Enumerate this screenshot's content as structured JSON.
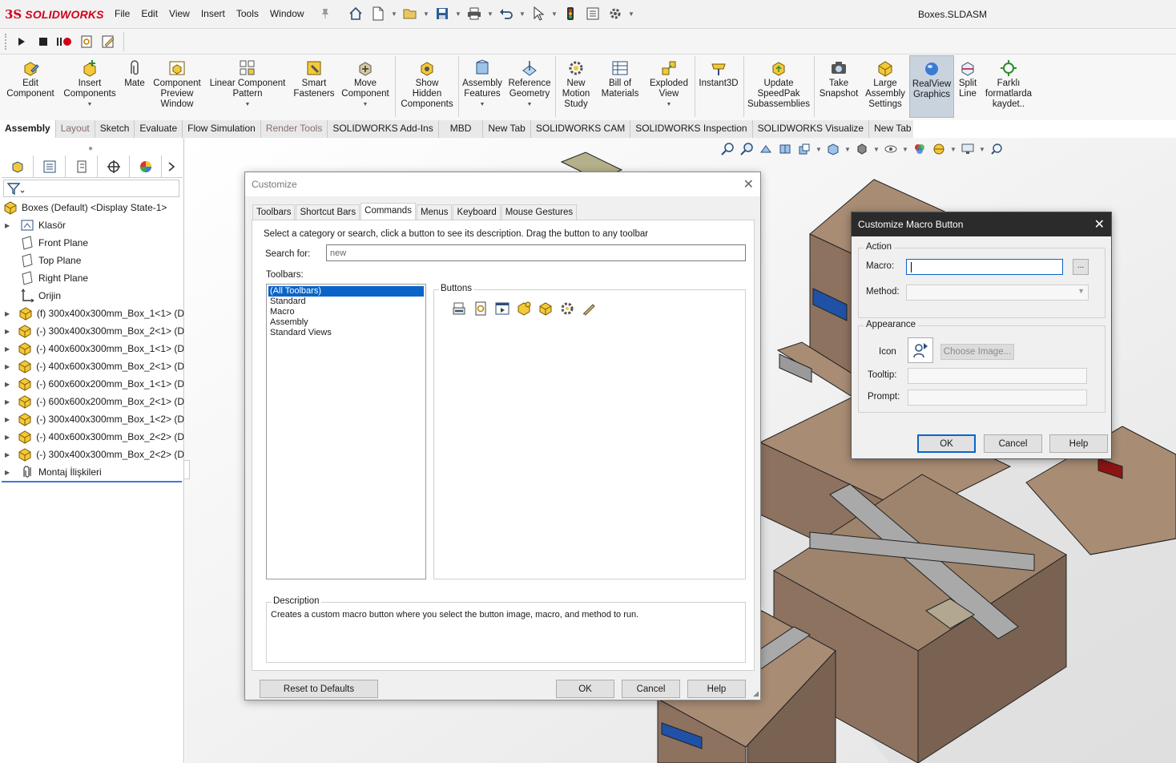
{
  "app": {
    "brand_prefix": "3S",
    "brand": "SOLIDWORKS",
    "document_title": "Boxes.SLDASM",
    "menus": [
      "File",
      "Edit",
      "View",
      "Insert",
      "Tools",
      "Window"
    ]
  },
  "ribbon": {
    "buttons": [
      {
        "label": "Edit\nComponent",
        "dropdown": false
      },
      {
        "label": "Insert\nComponents",
        "dropdown": true
      },
      {
        "label": "Mate",
        "dropdown": false
      },
      {
        "label": "Component\nPreview\nWindow",
        "dropdown": false
      },
      {
        "label": "Linear Component\nPattern",
        "dropdown": true
      },
      {
        "label": "Smart\nFasteners",
        "dropdown": false
      },
      {
        "label": "Move\nComponent",
        "dropdown": true
      },
      {
        "label": "Show\nHidden\nComponents",
        "dropdown": false
      },
      {
        "label": "Assembly\nFeatures",
        "dropdown": true
      },
      {
        "label": "Reference\nGeometry",
        "dropdown": true
      },
      {
        "label": "New\nMotion\nStudy",
        "dropdown": false
      },
      {
        "label": "Bill of\nMaterials",
        "dropdown": false
      },
      {
        "label": "Exploded\nView",
        "dropdown": true
      },
      {
        "label": "Instant3D",
        "dropdown": false
      },
      {
        "label": "Update\nSpeedPak\nSubassemblies",
        "dropdown": false
      },
      {
        "label": "Take\nSnapshot",
        "dropdown": false
      },
      {
        "label": "Large\nAssembly\nSettings",
        "dropdown": false
      },
      {
        "label": "RealView\nGraphics",
        "dropdown": false,
        "active": true
      },
      {
        "label": "Split\nLine",
        "dropdown": false
      },
      {
        "label": "Farklı\nformatlarda\nkaydet..",
        "dropdown": false
      }
    ]
  },
  "tabs": [
    "Assembly",
    "Layout",
    "Sketch",
    "Evaluate",
    "Flow Simulation",
    "Render Tools",
    "SOLIDWORKS Add-Ins",
    "MBD",
    "New Tab",
    "SOLIDWORKS CAM",
    "SOLIDWORKS Inspection",
    "SOLIDWORKS Visualize",
    "New Tab"
  ],
  "tree": {
    "root": "Boxes (Default) <Display State-1>",
    "items": [
      {
        "label": "Klasör",
        "type": "folder",
        "expandable": true
      },
      {
        "label": "Front Plane",
        "type": "plane",
        "expandable": false
      },
      {
        "label": "Top Plane",
        "type": "plane",
        "expandable": false
      },
      {
        "label": "Right Plane",
        "type": "plane",
        "expandable": false
      },
      {
        "label": "Orijin",
        "type": "origin",
        "expandable": false
      },
      {
        "label": "(f) 300x400x300mm_Box_1<1> (D",
        "type": "part",
        "expandable": true
      },
      {
        "label": "(-) 300x400x300mm_Box_2<1> (D",
        "type": "part",
        "expandable": true
      },
      {
        "label": "(-) 400x600x300mm_Box_1<1> (D",
        "type": "part",
        "expandable": true
      },
      {
        "label": "(-) 400x600x300mm_Box_2<1> (D",
        "type": "part",
        "expandable": true
      },
      {
        "label": "(-) 600x600x200mm_Box_1<1> (D",
        "type": "part",
        "expandable": true
      },
      {
        "label": "(-) 600x600x200mm_Box_2<1> (D",
        "type": "part",
        "expandable": true
      },
      {
        "label": "(-) 300x400x300mm_Box_1<2> (D",
        "type": "part",
        "expandable": true
      },
      {
        "label": "(-) 400x600x300mm_Box_2<2> (D",
        "type": "part",
        "expandable": true
      },
      {
        "label": "(-) 300x400x300mm_Box_2<2> (D",
        "type": "part",
        "expandable": true
      },
      {
        "label": "Montaj İlişkileri",
        "type": "mates",
        "expandable": true
      }
    ]
  },
  "customize": {
    "title": "Customize",
    "tabs": [
      "Toolbars",
      "Shortcut Bars",
      "Commands",
      "Menus",
      "Keyboard",
      "Mouse Gestures"
    ],
    "selected_tab": "Commands",
    "instruction": "Select a category or search, click a button to see its description. Drag the button to any toolbar",
    "search_label": "Search for:",
    "search_value": "new",
    "toolbars_label": "Toolbars:",
    "toolbars": [
      "(All Toolbars)",
      "Standard",
      "Macro",
      "Assembly",
      "Standard Views"
    ],
    "selected_toolbar": "(All Toolbars)",
    "buttons_label": "Buttons",
    "description_label": "Description",
    "description": "Creates a custom macro button where you select the button image, macro, and method to run.",
    "reset_label": "Reset to Defaults",
    "ok_label": "OK",
    "cancel_label": "Cancel",
    "help_label": "Help"
  },
  "macro_dialog": {
    "title": "Customize Macro Button",
    "action_label": "Action",
    "macro_label": "Macro:",
    "macro_value": "",
    "browse_label": "...",
    "method_label": "Method:",
    "appearance_label": "Appearance",
    "icon_label": "Icon",
    "choose_image_label": "Choose Image...",
    "tooltip_label": "Tooltip:",
    "prompt_label": "Prompt:",
    "ok_label": "OK",
    "cancel_label": "Cancel",
    "help_label": "Help"
  }
}
